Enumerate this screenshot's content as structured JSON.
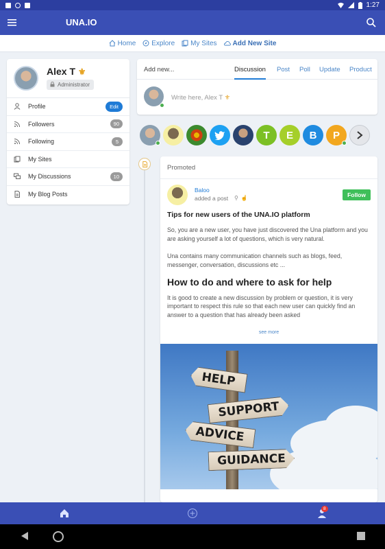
{
  "status_bar": {
    "time": "1:27"
  },
  "app_bar": {
    "title": "UNA.IO"
  },
  "top_nav": {
    "items": [
      {
        "label": "Home",
        "icon": "home-icon"
      },
      {
        "label": "Explore",
        "icon": "compass-icon"
      },
      {
        "label": "My Sites",
        "icon": "sites-icon"
      },
      {
        "label": "Add New Site",
        "icon": "cloud-icon"
      }
    ]
  },
  "profile": {
    "name": "Alex T",
    "role": "Administrator",
    "menu": [
      {
        "label": "Profile",
        "badge": "Edit",
        "icon": "user-icon"
      },
      {
        "label": "Followers",
        "badge": "90",
        "icon": "rss-icon"
      },
      {
        "label": "Following",
        "badge": "5",
        "icon": "rss-icon"
      },
      {
        "label": "My Sites",
        "badge": "",
        "icon": "sites-icon"
      },
      {
        "label": "My Discussions",
        "badge": "10",
        "icon": "discussions-icon"
      },
      {
        "label": "My Blog Posts",
        "badge": "",
        "icon": "document-icon"
      }
    ]
  },
  "composer": {
    "add_new_label": "Add new...",
    "tabs": [
      "Discussion",
      "Post",
      "Poll",
      "Update",
      "Product"
    ],
    "active_tab": "Discussion",
    "placeholder": "Write here, Alex T"
  },
  "avatars": {
    "letters": [
      "T",
      "E",
      "B",
      "P"
    ],
    "colors": {
      "T": "#7cc025",
      "E": "#a5cf2a",
      "B": "#1f8be0",
      "P": "#f2a71f",
      "twitter": "#1da1f2"
    }
  },
  "post": {
    "section_label": "Promoted",
    "author": "Baloo",
    "action": "added a post",
    "follow_label": "Follow",
    "title": "Tips for new users of the UNA.IO platform",
    "paragraph1": "So, you are a new user, you have just discovered the Una platform and you are asking yourself a lot of questions, which is very natural.",
    "paragraph2": "Una contains many communication channels such as blogs, feed, messenger, conversation, discussions etc ...",
    "heading": "How to do and where to ask for help",
    "paragraph3": "It is good to create a new discussion by problem or question, it is very important to respect this rule so that each new user can quickly find an answer to a question that has already been asked",
    "see_more": "see more",
    "image_signs": [
      "HELP",
      "SUPPORT",
      "ADVICE",
      "GUIDANCE"
    ]
  },
  "bottom_nav": {
    "notification_count": "8"
  }
}
